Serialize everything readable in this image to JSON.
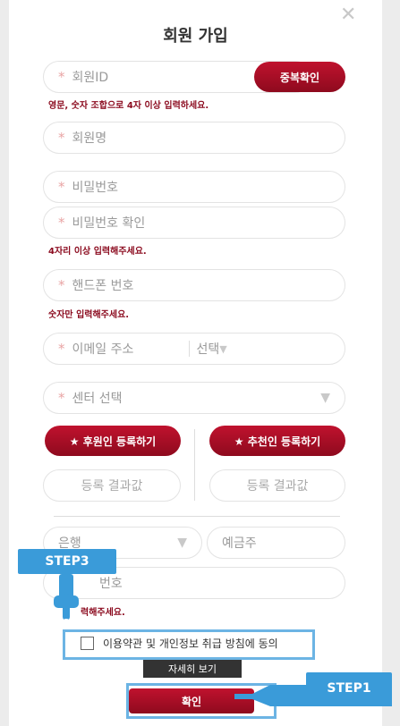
{
  "title": "회원 가입",
  "fields": {
    "member_id": "회원ID",
    "member_name": "회원명",
    "password": "비밀번호",
    "password_confirm": "비밀번호 확인",
    "phone": "핸드폰 번호",
    "email": "이메일 주소",
    "email_select": "선택",
    "center": "센터 선택",
    "bank": "은행",
    "depositor": "예금주",
    "account": "번호"
  },
  "buttons": {
    "dup_check": "중복확인",
    "sponsor": "★ 후원인 등록하기",
    "recommender": "★ 추천인 등록하기",
    "detail": "자세히 보기",
    "confirm": "확인"
  },
  "results": {
    "sponsor": "등록 결과값",
    "recommender": "등록 결과값"
  },
  "hints": {
    "id": "영문, 숫자 조합으로 4자 이상 입력하세요.",
    "password": "4자리 이상 입력해주세요.",
    "phone": "숫자만 입력해주세요.",
    "account": "력해주세요."
  },
  "agree_label": "이용약관 및 개인정보 취급 방침에 동의",
  "steps": {
    "step1": "STEP1",
    "step3": "STEP3"
  },
  "icons": {
    "close": "close-icon",
    "hand": "pointer-hand-icon",
    "dropdown": "triangle-down-icon"
  },
  "colors": {
    "accent": "#a40f25",
    "step_blue": "#3a9bd9",
    "hint_red": "#8b0a1e"
  }
}
